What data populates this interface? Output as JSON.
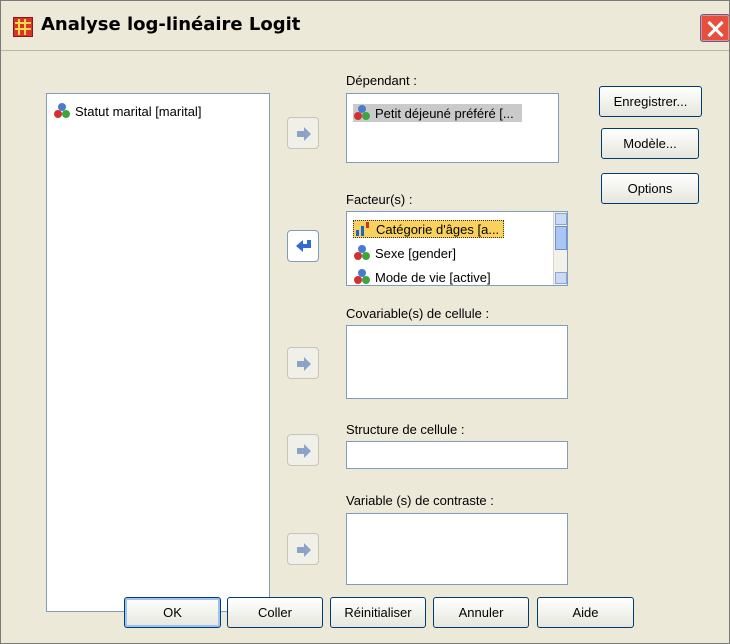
{
  "window": {
    "title": "Analyse log-linéaire Logit"
  },
  "source_list": {
    "items": [
      {
        "label": "Statut marital [marital]",
        "icon": "nominal-icon"
      }
    ]
  },
  "dependent": {
    "label": "Dépendant :",
    "items": [
      {
        "label": "Petit déjeuné préféré [...",
        "icon": "nominal-icon"
      }
    ]
  },
  "factors": {
    "label": "Facteur(s) :",
    "items": [
      {
        "label": "Catégorie d'âges [a...",
        "icon": "ordinal-icon"
      },
      {
        "label": "Sexe [gender]",
        "icon": "nominal-icon"
      },
      {
        "label": "Mode de vie [active]",
        "icon": "nominal-icon"
      }
    ]
  },
  "cell_covariates": {
    "label": "Covariable(s) de cellule :"
  },
  "cell_structure": {
    "label": "Structure de cellule :",
    "value": ""
  },
  "contrast_variables": {
    "label": "Variable (s) de contraste :"
  },
  "side_buttons": {
    "save": "Enregistrer...",
    "model": "Modèle...",
    "options": "Options"
  },
  "bottom_buttons": {
    "ok": "OK",
    "paste": "Coller",
    "reset": "Réinitialiser",
    "cancel": "Annuler",
    "help": "Aide"
  }
}
